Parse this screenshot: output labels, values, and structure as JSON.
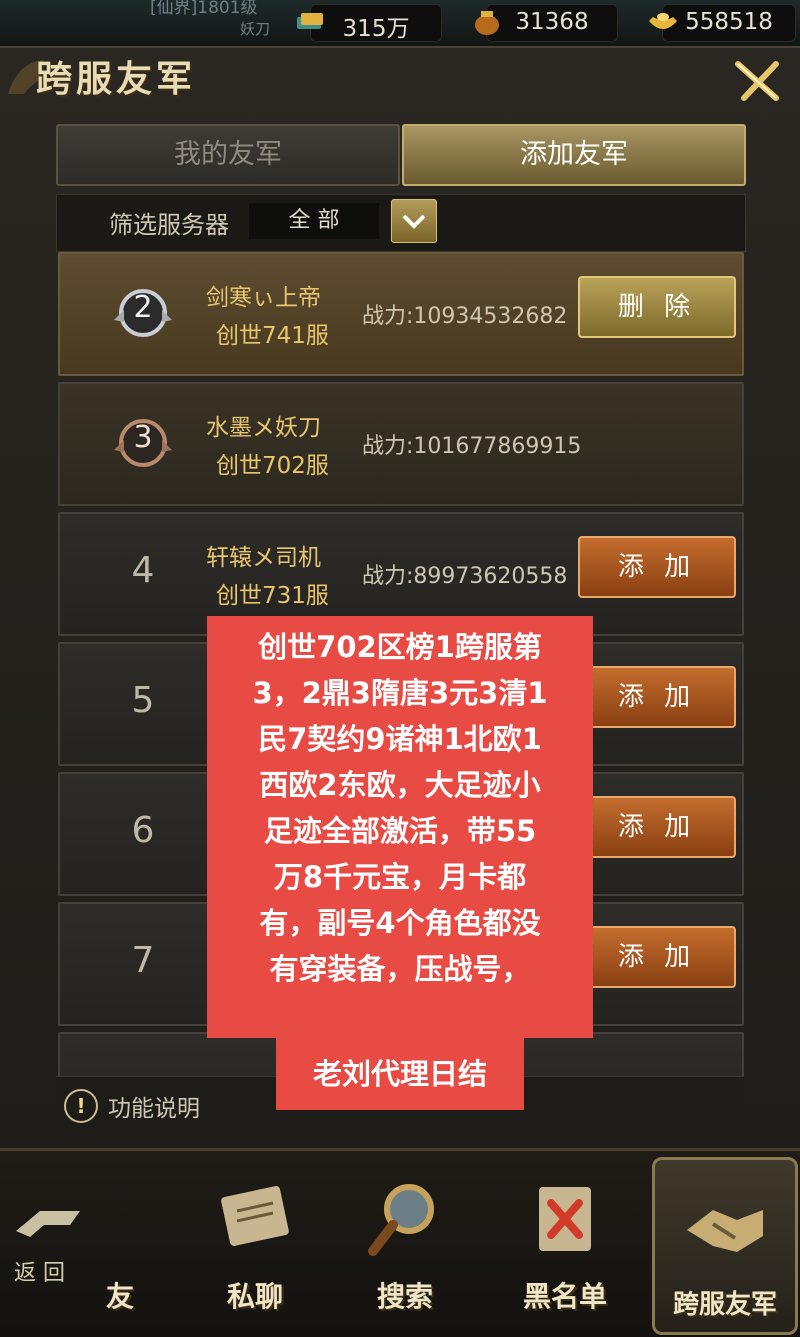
{
  "topbar": {
    "player_tag": "[仙界]1801级",
    "player_sub": "妖刀",
    "resources": [
      {
        "icon": "gold-bars-icon",
        "value": "315万"
      },
      {
        "icon": "treasure-pouch-icon",
        "value": "31368"
      },
      {
        "icon": "gold-ingot-icon",
        "value": "558518"
      }
    ]
  },
  "panel": {
    "title": "跨服友军",
    "tabs": [
      "我的友军",
      "添加友军"
    ],
    "filter": {
      "label": "筛选服务器",
      "value": "全 部"
    },
    "rows": [
      {
        "rank": "2",
        "name": "剑寒ぃ上帝",
        "server": "创世741服",
        "power": "战力:10934532682",
        "action": "删 除"
      },
      {
        "rank": "3",
        "name": "水墨メ妖刀",
        "server": "创世702服",
        "power": "战力:101677869915",
        "action": ""
      },
      {
        "rank": "4",
        "name": "轩辕メ司机",
        "server": "创世731服",
        "power": "战力:89973620558",
        "action": "添 加"
      },
      {
        "rank": "5",
        "name": "",
        "server": "",
        "power": "",
        "action": "添 加"
      },
      {
        "rank": "6",
        "name": "",
        "server": "",
        "power": "",
        "action": "添 加"
      },
      {
        "rank": "7",
        "name": "",
        "server": "",
        "power": "",
        "action": "添 加"
      }
    ],
    "help_label": "功能说明"
  },
  "note": {
    "lines": [
      "创世702区榜1跨服第",
      "3，2鼎3隋唐3元3清1",
      "民7契约9诸神1北欧1",
      "西欧2东欧，大足迹小",
      "足迹全部激活，带55",
      "万8千元宝，月卡都",
      "有，副号4个角色都没",
      "有穿装备，压战号，"
    ],
    "tail": "老刘代理日结"
  },
  "bottomnav": {
    "back_label": "返 回",
    "items": [
      {
        "label": "友",
        "icon": "friends-icon"
      },
      {
        "label": "私聊",
        "icon": "private-chat-scroll-icon"
      },
      {
        "label": "搜索",
        "icon": "magnifier-icon"
      },
      {
        "label": "黑名单",
        "icon": "blacklist-icon"
      },
      {
        "label": "跨服友军",
        "icon": "handshake-icon"
      }
    ]
  },
  "colors": {
    "accent_gold": "#e9c66e",
    "note_red": "#e84a44",
    "add_button": "#c46d2e"
  }
}
